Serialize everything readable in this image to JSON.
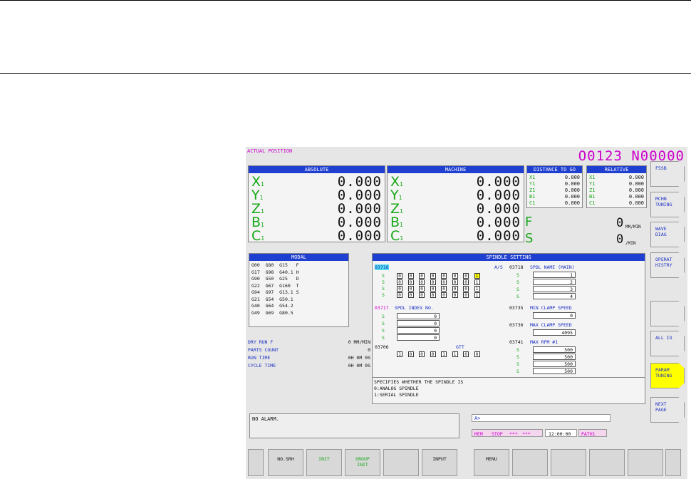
{
  "screen": {
    "title": "ACTUAL POSITION",
    "program": "O0123 N00000",
    "absolute": {
      "header": "ABSOLUTE",
      "rows": [
        {
          "axis": "X",
          "sub": "1",
          "value": "0.000"
        },
        {
          "axis": "Y",
          "sub": "1",
          "value": "0.000"
        },
        {
          "axis": "Z",
          "sub": "1",
          "value": "0.000"
        },
        {
          "axis": "B",
          "sub": "1",
          "value": "0.000"
        },
        {
          "axis": "C",
          "sub": "1",
          "value": "0.000"
        }
      ]
    },
    "machine": {
      "header": "MACHINE",
      "rows": [
        {
          "axis": "X",
          "sub": "1",
          "value": "0.000"
        },
        {
          "axis": "Y",
          "sub": "1",
          "value": "0.000"
        },
        {
          "axis": "Z",
          "sub": "1",
          "value": "0.000"
        },
        {
          "axis": "B",
          "sub": "1",
          "value": "0.000"
        },
        {
          "axis": "C",
          "sub": "1",
          "value": "0.000"
        }
      ]
    },
    "distance": {
      "header": "DISTANCE TO GO",
      "rows": [
        {
          "axis": "X1",
          "value": "0.000"
        },
        {
          "axis": "Y1",
          "value": "0.000"
        },
        {
          "axis": "Z1",
          "value": "0.000"
        },
        {
          "axis": "B1",
          "value": "0.000"
        },
        {
          "axis": "C1",
          "value": "0.000"
        }
      ]
    },
    "relative": {
      "header": "RELATIVE",
      "rows": [
        {
          "axis": "X1",
          "value": "0.000"
        },
        {
          "axis": "Y1",
          "value": "0.000"
        },
        {
          "axis": "Z1",
          "value": "0.000"
        },
        {
          "axis": "B1",
          "value": "0.000"
        },
        {
          "axis": "C1",
          "value": "0.000"
        }
      ]
    },
    "feed": {
      "label": "F",
      "value": "0",
      "unit": "MM/MIN"
    },
    "spindle": {
      "label": "S",
      "value": "0",
      "unit": "/MIN"
    },
    "modal": {
      "header": "MODAL",
      "lines": [
        "G00  G80  G15   F",
        "G17  G98  G40.1 H",
        "G90  G50  G25   D",
        "G22  G67  G160  T",
        "G94  G97  G13.1 S",
        "G21  G54  G50.1",
        "G40  G64  G54.2",
        "G49  G69  G80.5"
      ]
    },
    "status": [
      {
        "label": "DRY RUN F",
        "value": "0 MM/MIN"
      },
      {
        "label": "PARTS COUNT",
        "value": "0"
      },
      {
        "label": "RUN TIME",
        "value": "0H 0M 0S"
      },
      {
        "label": "CYCLE TIME",
        "value": "0H 0M 0S"
      }
    ],
    "spindle_setting": {
      "header": "SPINDLE SETTING",
      "p3716": "03716",
      "as_label": "A/S",
      "p3717": "03717",
      "p3717_name": "SPDL INDEX NO.",
      "p3706": "03706",
      "gtt_label": "GTT",
      "p3718": "03718",
      "p3718_name": "SPDL NAME (MAIN)",
      "p3735": "03735",
      "p3735_name": "MIN CLAMP SPEED",
      "p3736": "03736",
      "p3736_name": "MAX CLAMP SPEED",
      "p3741": "03741",
      "p3741_name": "MAX RPM #1",
      "s_label": "S",
      "bits_3716": [
        [
          "0",
          "0",
          "0",
          "0",
          "0",
          "0",
          "0",
          "1"
        ],
        [
          "0",
          "0",
          "0",
          "0",
          "0",
          "0",
          "0",
          "1"
        ],
        [
          "0",
          "0",
          "0",
          "0",
          "0",
          "0",
          "0",
          "1"
        ],
        [
          "0",
          "0",
          "0",
          "0",
          "0",
          "0",
          "0",
          "1"
        ]
      ],
      "index_values": [
        "0",
        "0",
        "0",
        "0"
      ],
      "bits_3706": [
        "1",
        "0",
        "0",
        "0",
        "1",
        "1",
        "0",
        "0"
      ],
      "names": [
        "1",
        "2",
        "3",
        "4"
      ],
      "min_clamp": "0",
      "max_clamp": "4095",
      "max_rpm": [
        "500",
        "500",
        "500",
        "500"
      ]
    },
    "help_text": [
      "SPECIFIES WHETHER THE SPINDLE IS",
      "0:ANALOG SPINDLE",
      "1:SERIAL SPINDLE"
    ],
    "alarm": "NO ALARM.",
    "input_prompt": "A>",
    "mode": "MEM",
    "run_state": "STOP",
    "motion_state": "***",
    "aux_state": "***",
    "clock": "12:00:00",
    "path": "PATH1",
    "side_keys": [
      {
        "label": "FSSB",
        "hl": false
      },
      {
        "label": "MCHN\nTUNING",
        "hl": false
      },
      {
        "label": "WAVE\nDIAG",
        "hl": false
      },
      {
        "label": "OPERAT\nHISTRY",
        "hl": false
      },
      {
        "label": "",
        "hl": false
      },
      {
        "label": "ALL IO",
        "hl": false
      },
      {
        "label": "PARAM\nTUNING",
        "hl": true
      },
      {
        "label": "NEXT\nPAGE",
        "hl": false
      }
    ],
    "soft_keys": [
      {
        "label": "NO.SRH",
        "green": false
      },
      {
        "label": "INIT",
        "green": true
      },
      {
        "label": "GROUP\nINIT",
        "green": true
      },
      {
        "label": "",
        "green": false
      },
      {
        "label": "INPUT",
        "green": false
      },
      {
        "label": "MENU",
        "green": false
      },
      {
        "label": "",
        "green": false
      },
      {
        "label": "",
        "green": false
      },
      {
        "label": "",
        "green": false
      },
      {
        "label": "",
        "green": false
      },
      {
        "label": "",
        "green": false
      }
    ]
  }
}
